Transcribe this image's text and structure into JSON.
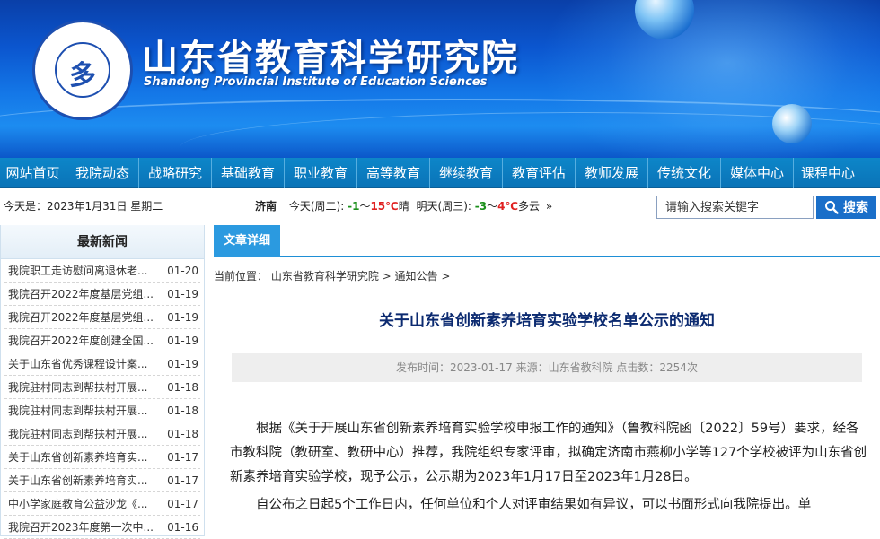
{
  "header": {
    "title": "山东省教育科学研究院",
    "subtitle": "Shandong Provincial Institute of Education Sciences",
    "seal_mark": "多",
    "colors": {
      "banner": "#0b56cf",
      "nav": "#0a73b7",
      "accent": "#2b9ae0"
    }
  },
  "nav": {
    "items": [
      "网站首页",
      "我院动态",
      "战略研究",
      "基础教育",
      "职业教育",
      "高等教育",
      "继续教育",
      "教育评估",
      "教师发展",
      "传统文化",
      "媒体中心",
      "课程中心"
    ]
  },
  "infobar": {
    "date": "今天是：2023年1月31日 星期二",
    "city": "济南",
    "today_label": "今天(周二):",
    "today_low": "-1",
    "today_sep": "～",
    "today_high": "15℃",
    "today_cond": "晴",
    "tomorrow_label": "明天(周三):",
    "tomorrow_low": "-3",
    "tomorrow_sep": "～",
    "tomorrow_high": "4℃",
    "tomorrow_cond": "多云",
    "more": "»"
  },
  "search": {
    "placeholder": "请输入搜索关键字",
    "button": "搜索",
    "icon": "search-icon"
  },
  "sidebar": {
    "title": "最新新闻",
    "items": [
      {
        "title": "我院职工走访慰问离退休老...",
        "date": "01-20"
      },
      {
        "title": "我院召开2022年度基层党组...",
        "date": "01-19"
      },
      {
        "title": "我院召开2022年度基层党组...",
        "date": "01-19"
      },
      {
        "title": "我院召开2022年度创建全国...",
        "date": "01-19"
      },
      {
        "title": "关于山东省优秀课程设计案...",
        "date": "01-19"
      },
      {
        "title": "我院驻村同志到帮扶村开展...",
        "date": "01-18"
      },
      {
        "title": "我院驻村同志到帮扶村开展...",
        "date": "01-18"
      },
      {
        "title": "我院驻村同志到帮扶村开展...",
        "date": "01-18"
      },
      {
        "title": "关于山东省创新素养培育实...",
        "date": "01-17"
      },
      {
        "title": "关于山东省创新素养培育实...",
        "date": "01-17"
      },
      {
        "title": "中小学家庭教育公益沙龙《...",
        "date": "01-17"
      },
      {
        "title": "我院召开2023年度第一次中...",
        "date": "01-16"
      }
    ]
  },
  "main": {
    "tab": "文章详细",
    "crumb_prefix": "当前位置：",
    "crumb_home": "山东省教育科学研究院",
    "crumb_sep": " > ",
    "crumb_section": "通知公告",
    "crumb_end": " >",
    "title": "关于山东省创新素养培育实验学校名单公示的通知",
    "meta": "发布时间：2023-01-17 来源：山东省教科院 点击数：2254次",
    "paragraphs": [
      "根据《关于开展山东省创新素养培育实验学校申报工作的通知》（鲁教科院函〔2022〕59号）要求，经各市教科院（教研室、教研中心）推荐，我院组织专家评审，拟确定济南市燕柳小学等127个学校被评为山东省创新素养培育实验学校，现予公示，公示期为2023年1月17日至2023年1月28日。",
      "自公布之日起5个工作日内，任何单位和个人对评审结果如有异议，可以书面形式向我院提出。单"
    ]
  }
}
